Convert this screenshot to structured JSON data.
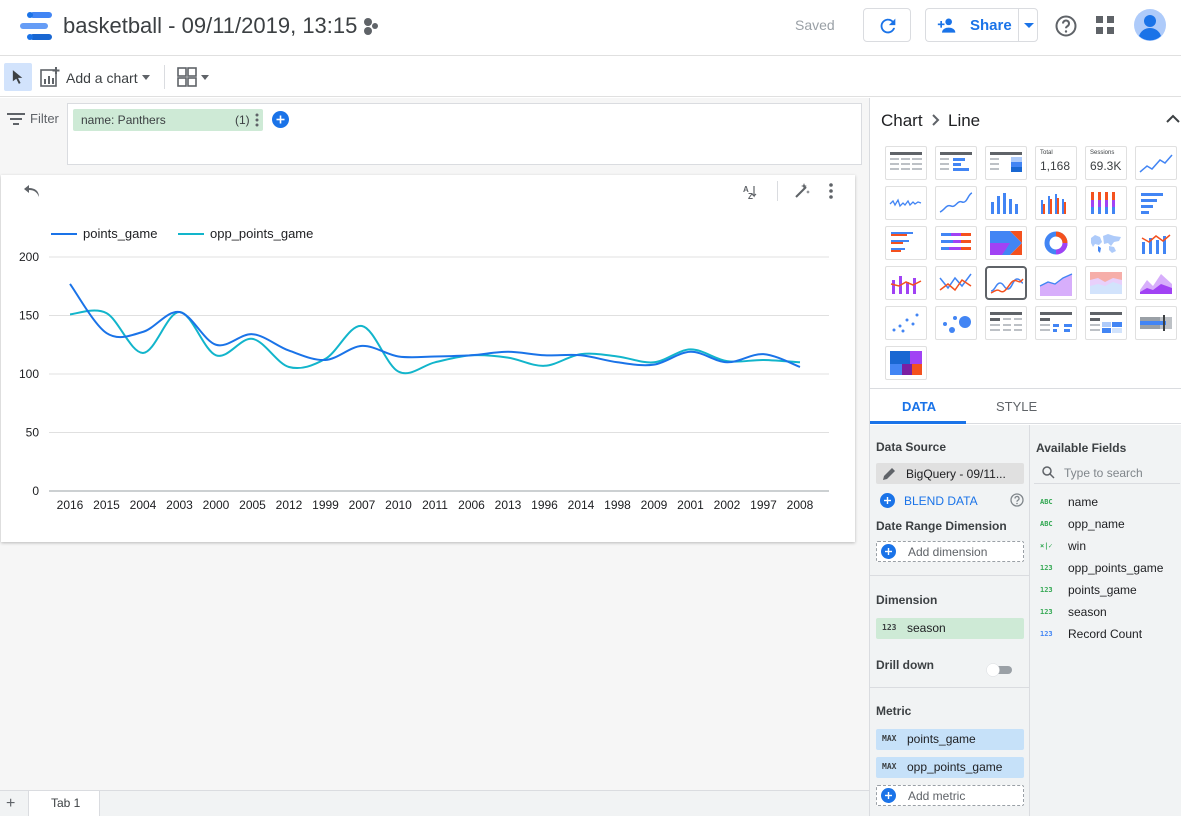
{
  "header": {
    "title": "basketball - 09/11/2019, 13:15",
    "saved_status": "Saved",
    "share_label": "Share"
  },
  "toolbar": {
    "add_chart_label": "Add a chart"
  },
  "filter": {
    "label": "Filter",
    "chip_text": "name: Panthers",
    "chip_count": "(1)"
  },
  "page_tabs": [
    {
      "label": "Tab 1"
    }
  ],
  "panel": {
    "breadcrumb": [
      "Chart",
      "Line"
    ],
    "chart_type_scorecards": {
      "total_label": "Total",
      "total_value": "1,168",
      "sessions_label": "Sessions",
      "sessions_value": "69.3K"
    },
    "tabs": [
      "DATA",
      "STYLE"
    ],
    "data_source_label": "Data Source",
    "data_source_value": "BigQuery - 09/11...",
    "blend_label": "BLEND DATA",
    "date_range_label": "Date Range Dimension",
    "add_dimension_label": "Add dimension",
    "dimension_label": "Dimension",
    "dimension_field": {
      "tag": "123",
      "name": "season"
    },
    "drill_down_label": "Drill down",
    "metric_label": "Metric",
    "metrics": [
      {
        "tag": "MAX",
        "name": "points_game"
      },
      {
        "tag": "MAX",
        "name": "opp_points_game"
      }
    ],
    "add_metric_label": "Add metric",
    "available_fields_label": "Available Fields",
    "search_placeholder": "Type to search",
    "available_fields": [
      {
        "tag": "ABC",
        "name": "name",
        "color": "#34a853"
      },
      {
        "tag": "ABC",
        "name": "opp_name",
        "color": "#34a853"
      },
      {
        "tag": "×|✓",
        "name": "win",
        "color": "#34a853"
      },
      {
        "tag": "123",
        "name": "opp_points_game",
        "color": "#34a853"
      },
      {
        "tag": "123",
        "name": "points_game",
        "color": "#34a853"
      },
      {
        "tag": "123",
        "name": "season",
        "color": "#34a853"
      },
      {
        "tag": "123",
        "name": "Record Count",
        "color": "#4285f4"
      }
    ]
  },
  "colors": {
    "accent": "#1a73e8",
    "dimension_chip": "#ceead6",
    "metric_chip": "#c6e1f9"
  },
  "chart_data": {
    "type": "line",
    "categories": [
      "2016",
      "2015",
      "2004",
      "2003",
      "2000",
      "2005",
      "2012",
      "1999",
      "2007",
      "2010",
      "2011",
      "2006",
      "2013",
      "1996",
      "2014",
      "1998",
      "2009",
      "2001",
      "2002",
      "1997",
      "2008"
    ],
    "series": [
      {
        "name": "points_game",
        "color": "#1a73e8",
        "values": [
          177,
          135,
          136,
          153,
          125,
          134,
          120,
          112,
          124,
          115,
          115,
          116,
          119,
          116,
          116,
          110,
          108,
          119,
          110,
          117,
          106
        ]
      },
      {
        "name": "opp_points_game",
        "color": "#12b5cb",
        "values": [
          151,
          152,
          118,
          153,
          116,
          130,
          106,
          113,
          141,
          102,
          110,
          116,
          114,
          107,
          117,
          115,
          110,
          121,
          111,
          112,
          110
        ]
      }
    ],
    "ylim": [
      0,
      200
    ],
    "yticks": [
      0,
      50,
      100,
      150,
      200
    ],
    "grid": true,
    "legend": "top-left"
  }
}
